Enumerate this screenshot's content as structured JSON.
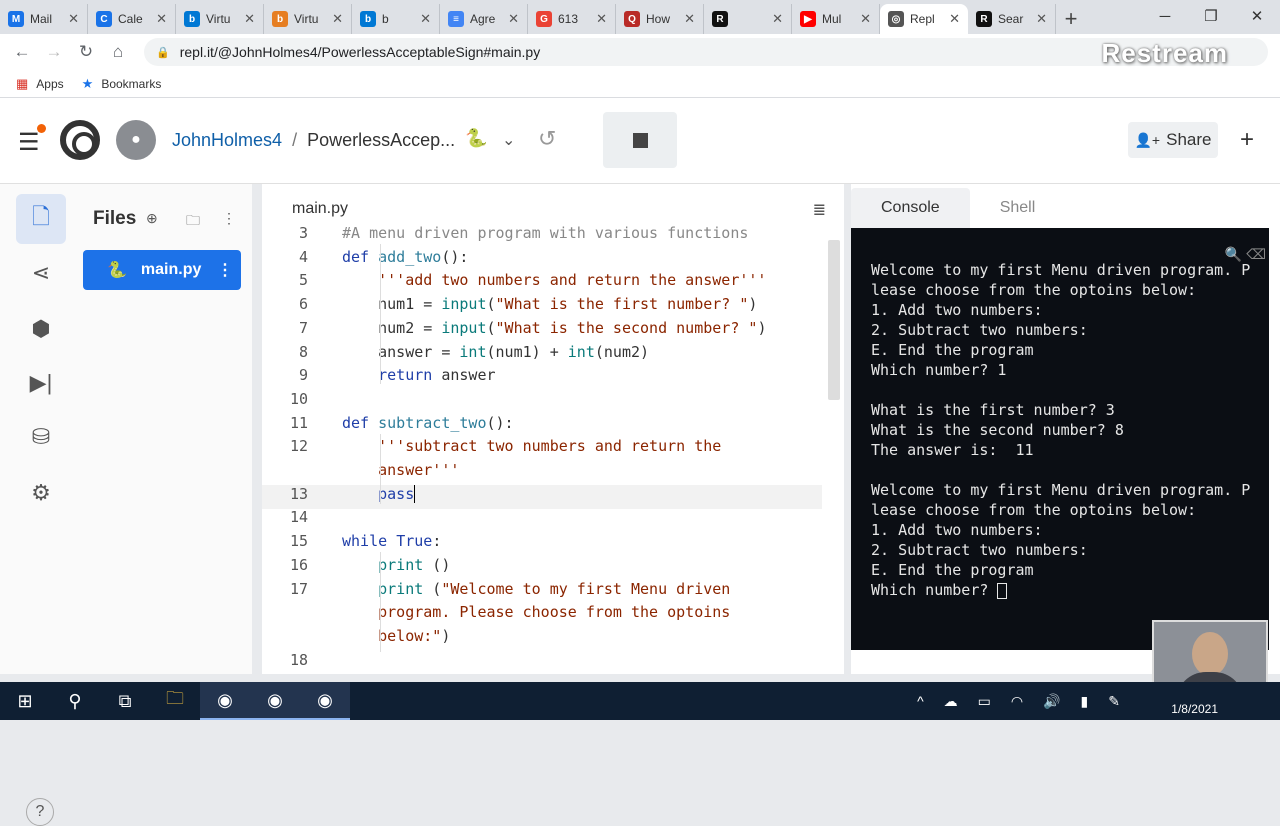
{
  "browser": {
    "tabs": [
      {
        "label": "Mail",
        "fav": "M",
        "color": "#1a73e8"
      },
      {
        "label": "Cale",
        "fav": "C",
        "color": "#1a73e8"
      },
      {
        "label": "Virtu",
        "fav": "b",
        "color": "#0078d4"
      },
      {
        "label": "Virtu",
        "fav": "b",
        "color": "#e67e22"
      },
      {
        "label": "b",
        "fav": "b",
        "color": "#0078d4"
      },
      {
        "label": "Agre",
        "fav": "≡",
        "color": "#4285f4"
      },
      {
        "label": "613",
        "fav": "G",
        "color": "#ea4335"
      },
      {
        "label": "How",
        "fav": "Q",
        "color": "#b92b27"
      },
      {
        "label": "",
        "fav": "R",
        "color": "#111"
      },
      {
        "label": "Mul",
        "fav": "▶",
        "color": "#ff0000"
      },
      {
        "label": "Repl",
        "fav": "◎",
        "color": "#555"
      },
      {
        "label": "Sear",
        "fav": "R",
        "color": "#111"
      }
    ],
    "url": "repl.it/@JohnHolmes4/PowerlessAcceptableSign#main.py",
    "watermark": "Restream",
    "bookmarks": [
      {
        "icon": "apps-icon",
        "label": "Apps"
      },
      {
        "icon": "star-icon",
        "label": "Bookmarks"
      }
    ]
  },
  "header": {
    "username": "JohnHolmes4",
    "separator": "/",
    "repl_name": "PowerlessAccep...",
    "share_label": "Share"
  },
  "files": {
    "title": "Files",
    "items": [
      {
        "name": "main.py"
      }
    ]
  },
  "editor": {
    "tab": "main.py",
    "lines": [
      {
        "n": "3",
        "html": "<span class='cm'>#A menu driven program with various functions</span>"
      },
      {
        "n": "4",
        "html": "<span class='kw'>def</span> <span class='fn'>add_two</span>():"
      },
      {
        "n": "5",
        "html": "    <span class='st'>'''add two numbers and return the answer'''</span>"
      },
      {
        "n": "6",
        "html": "    num1 = <span class='bi'>input</span>(<span class='st'>\"What is the first number? \"</span>)"
      },
      {
        "n": "7",
        "html": "    num2 = <span class='bi'>input</span>(<span class='st'>\"What is the second number? \"</span>)"
      },
      {
        "n": "8",
        "html": "    answer = <span class='bi'>int</span>(num1) + <span class='bi'>int</span>(num2)"
      },
      {
        "n": "9",
        "html": "    <span class='kw'>return</span> answer"
      },
      {
        "n": "10",
        "html": ""
      },
      {
        "n": "11",
        "html": "<span class='kw'>def</span> <span class='fn'>subtract_two</span>():"
      },
      {
        "n": "12",
        "html": "    <span class='st'>'''subtract two numbers and return the</span>"
      },
      {
        "n": "",
        "html": "    <span class='st'>answer'''</span>"
      },
      {
        "n": "13",
        "html": "    <span class='kw'>pass</span><span class='cursor'></span>"
      },
      {
        "n": "14",
        "html": ""
      },
      {
        "n": "15",
        "html": "<span class='kw'>while</span> <span class='kw'>True</span>:"
      },
      {
        "n": "16",
        "html": "    <span class='bi'>print</span> ()"
      },
      {
        "n": "17",
        "html": "    <span class='bi'>print</span> (<span class='st'>\"Welcome to my first Menu driven</span>"
      },
      {
        "n": "",
        "html": "    <span class='st'>program. Please choose from the optoins</span>"
      },
      {
        "n": "",
        "html": "    <span class='st'>below:\"</span>)"
      },
      {
        "n": "18",
        "html": ""
      }
    ]
  },
  "console": {
    "tabs": [
      "Console",
      "Shell"
    ],
    "output": "Welcome to my first Menu driven program. Please choose from the optoins below:\n1. Add two numbers:\n2. Subtract two numbers:\nE. End the program\nWhich number? 1\n\nWhat is the first number? 3\nWhat is the second number? 8\nThe answer is:  11\n\nWelcome to my first Menu driven program. Please choose from the optoins below:\n1. Add two numbers:\n2. Subtract two numbers:\nE. End the program\nWhich number? "
  },
  "taskbar": {
    "date": "1/8/2021"
  }
}
